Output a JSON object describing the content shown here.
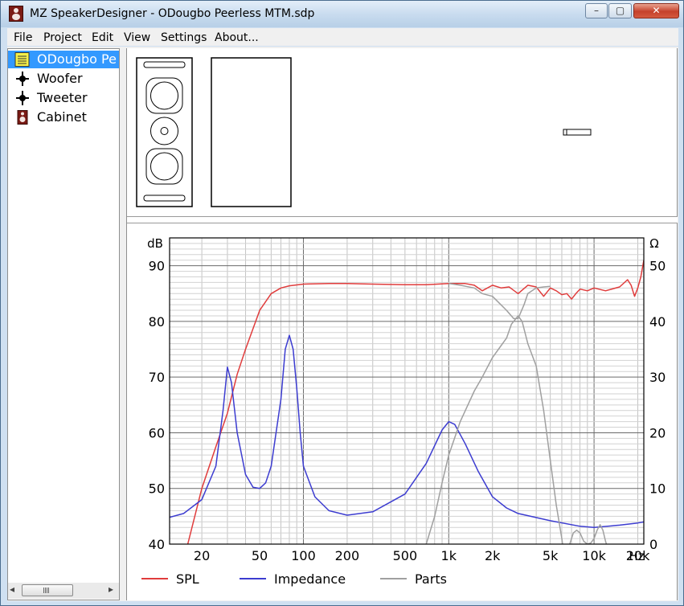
{
  "window": {
    "title": "MZ SpeakerDesigner - ODougbo Peerless MTM.sdp",
    "controls": {
      "minimize": "–",
      "maximize": "▢",
      "close": "✕"
    }
  },
  "menu": {
    "items": [
      "File",
      "Project",
      "Edit",
      "View",
      "Settings",
      "About..."
    ]
  },
  "tree": {
    "items": [
      {
        "label": "ODougbo Pe",
        "icon": "project-icon",
        "selected": true
      },
      {
        "label": "Woofer",
        "icon": "driver-icon",
        "selected": false
      },
      {
        "label": "Tweeter",
        "icon": "driver-icon",
        "selected": false
      },
      {
        "label": "Cabinet",
        "icon": "cabinet-icon",
        "selected": false
      }
    ],
    "scroll_left": "◂",
    "scroll_right": "▸"
  },
  "chart_data": {
    "type": "line",
    "x_scale": "log",
    "xlim": [
      12,
      22000
    ],
    "ylim_left": [
      40,
      95
    ],
    "ylim_right": [
      0,
      55
    ],
    "ylabel_left": "dB",
    "ylabel_right": "Ω",
    "xlabel": "Hz",
    "y_ticks_left": [
      "40",
      "50",
      "60",
      "70",
      "80",
      "90"
    ],
    "y_ticks_right": [
      "0",
      "10",
      "20",
      "30",
      "40",
      "50"
    ],
    "x_ticks": [
      {
        "label": "20",
        "value": 20
      },
      {
        "label": "50",
        "value": 50
      },
      {
        "label": "100",
        "value": 100
      },
      {
        "label": "200",
        "value": 200
      },
      {
        "label": "500",
        "value": 500
      },
      {
        "label": "1k",
        "value": 1000
      },
      {
        "label": "2k",
        "value": 2000
      },
      {
        "label": "5k",
        "value": 5000
      },
      {
        "label": "10k",
        "value": 10000
      },
      {
        "label": "20k",
        "value": 20000
      }
    ],
    "grid": true,
    "legend": [
      {
        "name": "SPL",
        "color": "#e03c3c"
      },
      {
        "name": "Impedance",
        "color": "#3c3cd0"
      },
      {
        "name": "Parts",
        "color": "#a0a0a0"
      }
    ],
    "series": [
      {
        "name": "SPL",
        "axis": "left",
        "color": "#e03c3c",
        "x": [
          16,
          20,
          25,
          30,
          35,
          40,
          50,
          60,
          70,
          80,
          100,
          150,
          200,
          300,
          500,
          700,
          1000,
          1300,
          1500,
          1700,
          2000,
          2300,
          2600,
          3000,
          3500,
          4000,
          4500,
          5000,
          5500,
          6000,
          6500,
          7000,
          7500,
          8000,
          9000,
          10000,
          12000,
          15000,
          17000,
          18000,
          19000,
          20000,
          21000,
          22000
        ],
        "y": [
          40,
          50,
          57.5,
          63.5,
          70.5,
          75,
          82,
          85,
          86,
          86.4,
          86.7,
          86.8,
          86.8,
          86.7,
          86.6,
          86.6,
          86.8,
          86.8,
          86.5,
          85.5,
          86.5,
          86,
          86.2,
          85,
          86.5,
          86.2,
          84.5,
          86,
          85.5,
          84.8,
          85,
          84,
          85,
          85.8,
          85.5,
          86,
          85.5,
          86.2,
          87.5,
          86.5,
          84.5,
          86,
          88,
          91
        ]
      },
      {
        "name": "Impedance",
        "axis": "right",
        "color": "#3c3cd0",
        "x": [
          12,
          15,
          20,
          25,
          28,
          30,
          32,
          35,
          40,
          45,
          50,
          55,
          60,
          70,
          75,
          80,
          85,
          90,
          95,
          100,
          120,
          150,
          200,
          300,
          500,
          700,
          900,
          1000,
          1100,
          1300,
          1600,
          2000,
          2500,
          3000,
          5000,
          8000,
          10000,
          15000,
          20000,
          22000
        ],
        "y": [
          4.8,
          5.5,
          8,
          14,
          24,
          31.8,
          29,
          20,
          12.5,
          10.2,
          10,
          11,
          14,
          26,
          35,
          37.5,
          35,
          28,
          20,
          14,
          8.5,
          6,
          5.2,
          5.8,
          9,
          14.5,
          20.5,
          22,
          21.5,
          18,
          13,
          8.5,
          6.5,
          5.5,
          4.2,
          3.2,
          3,
          3.4,
          3.8,
          4
        ]
      },
      {
        "name": "Parts (woofer)",
        "axis": "left",
        "color": "#a0a0a0",
        "x": [
          700,
          800,
          900,
          1000,
          1200,
          1500,
          1700,
          2000,
          2200,
          2500,
          2700,
          3000,
          3200,
          3500,
          4000,
          4500,
          5000,
          5500,
          6000,
          6300
        ],
        "y": [
          40,
          45,
          51,
          56,
          62,
          67.5,
          70,
          73.5,
          75,
          77,
          79.5,
          81,
          80,
          76,
          72,
          64,
          55,
          47,
          41,
          37
        ]
      },
      {
        "name": "Parts (tweeter)",
        "axis": "left",
        "color": "#a0a0a0",
        "x": [
          1000,
          1200,
          1500,
          1700,
          2000,
          2500,
          2800,
          3000,
          3300,
          3500,
          4000,
          4500,
          5000
        ],
        "y": [
          86.8,
          86.5,
          86,
          85,
          84.5,
          82,
          80.5,
          80.5,
          83,
          85,
          86,
          86.2,
          86.3
        ]
      },
      {
        "name": "Parts (bumps)",
        "axis": "left",
        "color": "#a0a0a0",
        "x": [
          6800,
          7200,
          7600,
          8000,
          8500,
          9000,
          9500,
          10000,
          10500,
          11000,
          11500,
          12000,
          12500,
          13000
        ],
        "y": [
          40,
          42,
          42.5,
          42,
          40.5,
          40,
          40.2,
          41,
          42.5,
          43.5,
          42.5,
          40.5,
          39,
          38
        ]
      }
    ]
  }
}
